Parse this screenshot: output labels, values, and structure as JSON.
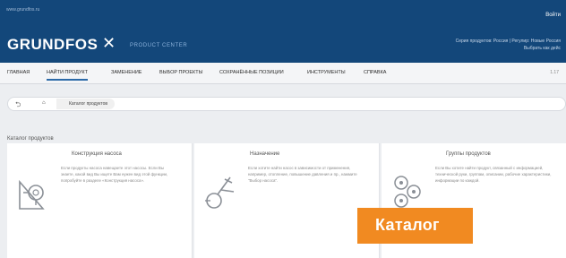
{
  "topbar": {
    "url": "www.grundfos.ru",
    "login": "Войти",
    "logo": "GRUNDFOS",
    "product_center": "PRODUCT CENTER",
    "selector_line1": "Серия продуктов: Россия | Регулир: Новые Россия",
    "selector_line2": "Выбрать как дейс"
  },
  "nav": {
    "items": [
      "ГЛАВНАЯ",
      "НАЙТИ ПРОДУКТ",
      "ЗАМЕНЕНИЕ",
      "ВЫБОР ПРОЕКТЫ",
      "СОХРАНЁННЫЕ ПОЗИЦИИ",
      "ИНСТРУМЕНТЫ",
      "СПРАВКА"
    ],
    "active_index": 1,
    "right": "1.17"
  },
  "breadcrumb": {
    "home": "⌂",
    "item": "Каталог продуктов"
  },
  "section": "Каталог продуктов",
  "cards": [
    {
      "title": "Конструкция насоса",
      "desc": "Если продукты насоса навещаете этот насосы. Если Вы знаете, какой вид Вы ищете Вам нужен вид этой функции, попробуйте в разделе «Конструкция насоса».",
      "icon": "pump-construction-icon"
    },
    {
      "title": "Назначение",
      "desc": "Если хотите найти насос в зависимости от применения, например, отопление, повышение давления и пр., нажмите \"Выбор насоса\".",
      "icon": "application-icon"
    },
    {
      "title": "Группы продуктов",
      "desc": "Если Вы хотите найти продукт, связанный с информацией, технической руки, группам, описании, рабочие характеристики, информации по каждой.",
      "icon": "product-groups-icon"
    }
  ],
  "badge": "Каталог"
}
